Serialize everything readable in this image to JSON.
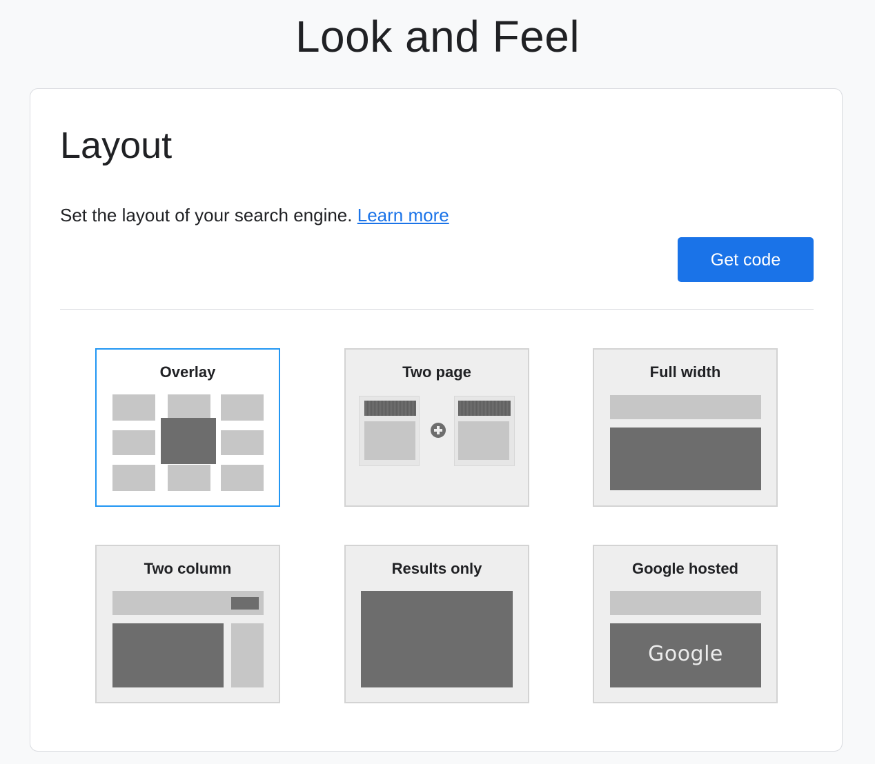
{
  "page": {
    "title": "Look and Feel"
  },
  "layout_section": {
    "title": "Layout",
    "description": "Set the layout of your search engine.",
    "learn_more_label": "Learn more",
    "get_code_label": "Get code"
  },
  "layout_options": [
    {
      "label": "Overlay",
      "selected": true
    },
    {
      "label": "Two page",
      "selected": false
    },
    {
      "label": "Full width",
      "selected": false
    },
    {
      "label": "Two column",
      "selected": false
    },
    {
      "label": "Results only",
      "selected": false
    },
    {
      "label": "Google hosted",
      "selected": false
    }
  ],
  "google_hosted_logo_text": "Google",
  "colors": {
    "accent": "#1a73e8",
    "selected_border": "#2196f3",
    "thumbnail_light": "#c6c6c6",
    "thumbnail_dark": "#6d6d6d"
  }
}
